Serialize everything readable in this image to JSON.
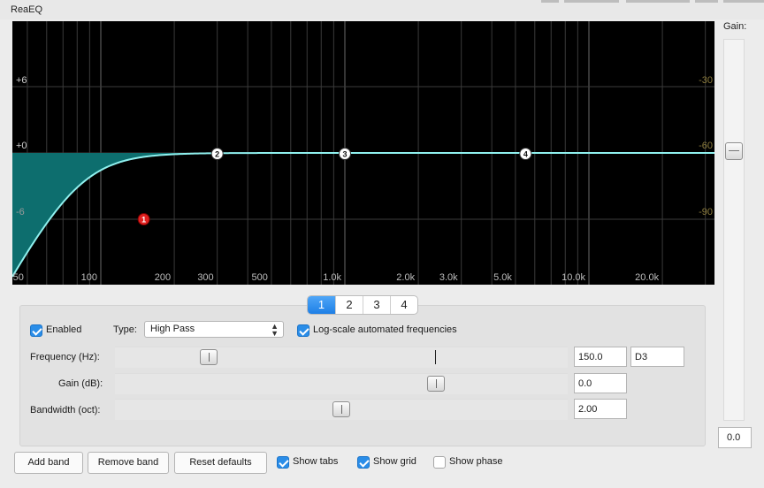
{
  "window": {
    "title": "ReaEQ"
  },
  "graph": {
    "db_labels": [
      "+6",
      "+0",
      "-6"
    ],
    "right_labels": [
      "-30",
      "-60",
      "-90"
    ],
    "freq_labels": [
      "50",
      "100",
      "200",
      "300",
      "500",
      "1.0k",
      "2.0k",
      "3.0k",
      "5.0k",
      "10.0k",
      "20.0k"
    ],
    "bands": [
      {
        "id": "1",
        "freq_hz": 150,
        "active": true
      },
      {
        "id": "2",
        "freq_hz": 300,
        "active": false
      },
      {
        "id": "3",
        "freq_hz": 1000,
        "active": false
      },
      {
        "id": "4",
        "freq_hz": 5500,
        "active": false
      }
    ],
    "fill_color": "#0d6e6e",
    "curve_color": "#8ff0ee",
    "active_node_color": "#e0201f"
  },
  "gain": {
    "label": "Gain:",
    "value": "0.0"
  },
  "tabs": [
    "1",
    "2",
    "3",
    "4"
  ],
  "band": {
    "enabled_label": "Enabled",
    "type_label": "Type:",
    "type_value": "High Pass",
    "logscale_label": "Log-scale automated frequencies",
    "frequency": {
      "label": "Frequency (Hz):",
      "value": "150.0",
      "note": "D3"
    },
    "gain": {
      "label": "Gain (dB):",
      "value": "0.0"
    },
    "bandwidth": {
      "label": "Bandwidth (oct):",
      "value": "2.00"
    }
  },
  "footer": {
    "add_band": "Add band",
    "remove_band": "Remove band",
    "reset_defaults": "Reset defaults",
    "show_tabs": "Show tabs",
    "show_grid": "Show grid",
    "show_phase": "Show phase"
  },
  "colors": {
    "accent": "#2a8de8"
  }
}
